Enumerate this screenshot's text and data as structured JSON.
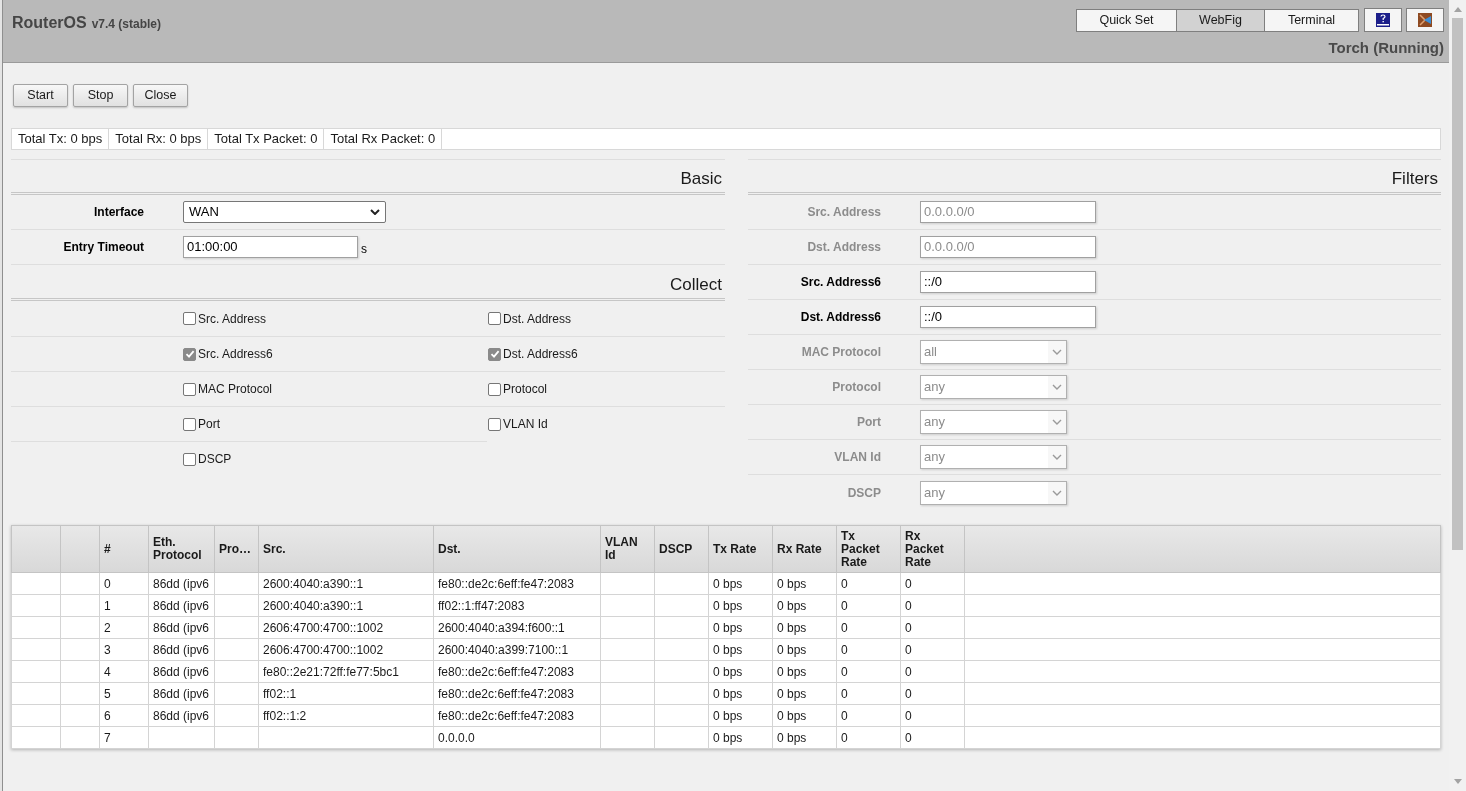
{
  "header": {
    "product": "RouterOS",
    "version": "v7.4 (stable)",
    "tabs": [
      {
        "label": "Quick Set",
        "selected": false
      },
      {
        "label": "WebFig",
        "selected": true
      },
      {
        "label": "Terminal",
        "selected": false
      }
    ],
    "page_title": "Torch (Running)"
  },
  "toolbar": {
    "buttons": [
      "Start",
      "Stop",
      "Close"
    ]
  },
  "status_bar": [
    "Total Tx: 0 bps",
    "Total Rx: 0 bps",
    "Total Tx Packet: 0",
    "Total Rx Packet: 0"
  ],
  "basic": {
    "title": "Basic",
    "fields": [
      {
        "label": "Interface",
        "kind": "select",
        "value": "WAN"
      },
      {
        "label": "Entry Timeout",
        "kind": "text",
        "value": "01:00:00",
        "unit": "s"
      }
    ]
  },
  "collect": {
    "title": "Collect",
    "options": [
      {
        "label": "Src. Address",
        "checked": false
      },
      {
        "label": "Dst. Address",
        "checked": false
      },
      {
        "label": "Src. Address6",
        "checked": true
      },
      {
        "label": "Dst. Address6",
        "checked": true
      },
      {
        "label": "MAC Protocol",
        "checked": false
      },
      {
        "label": "Protocol",
        "checked": false
      },
      {
        "label": "Port",
        "checked": false
      },
      {
        "label": "VLAN Id",
        "checked": false
      },
      {
        "label": "DSCP",
        "checked": false
      }
    ]
  },
  "filters": {
    "title": "Filters",
    "fields": [
      {
        "label": "Src. Address",
        "kind": "text",
        "value": "0.0.0.0/0",
        "disabled": true
      },
      {
        "label": "Dst. Address",
        "kind": "text",
        "value": "0.0.0.0/0",
        "disabled": true
      },
      {
        "label": "Src. Address6",
        "kind": "text",
        "value": "::/0",
        "disabled": false
      },
      {
        "label": "Dst. Address6",
        "kind": "text",
        "value": "::/0",
        "disabled": false
      },
      {
        "label": "MAC Protocol",
        "kind": "select",
        "value": "all",
        "disabled": true
      },
      {
        "label": "Protocol",
        "kind": "select",
        "value": "any",
        "disabled": true
      },
      {
        "label": "Port",
        "kind": "select",
        "value": "any",
        "disabled": true
      },
      {
        "label": "VLAN Id",
        "kind": "select",
        "value": "any",
        "disabled": true
      },
      {
        "label": "DSCP",
        "kind": "select",
        "value": "any",
        "disabled": true
      }
    ]
  },
  "table": {
    "columns": [
      null,
      null,
      "#",
      "Eth. Protocol",
      "Pro…",
      "Src.",
      "Dst.",
      "VLAN Id",
      "DSCP",
      "Tx Rate",
      "Rx Rate",
      "Tx Packet Rate",
      "Rx Packet Rate"
    ],
    "rows": [
      [
        null,
        null,
        "0",
        "86dd (ipv6",
        null,
        "2600:4040:a390::1",
        "fe80::de2c:6eff:fe47:2083",
        null,
        null,
        "0 bps",
        "0 bps",
        "0",
        "0"
      ],
      [
        null,
        null,
        "1",
        "86dd (ipv6",
        null,
        "2600:4040:a390::1",
        "ff02::1:ff47:2083",
        null,
        null,
        "0 bps",
        "0 bps",
        "0",
        "0"
      ],
      [
        null,
        null,
        "2",
        "86dd (ipv6",
        null,
        "2606:4700:4700::1002",
        "2600:4040:a394:f600::1",
        null,
        null,
        "0 bps",
        "0 bps",
        "0",
        "0"
      ],
      [
        null,
        null,
        "3",
        "86dd (ipv6",
        null,
        "2606:4700:4700::1002",
        "2600:4040:a399:7100::1",
        null,
        null,
        "0 bps",
        "0 bps",
        "0",
        "0"
      ],
      [
        null,
        null,
        "4",
        "86dd (ipv6",
        null,
        "fe80::2e21:72ff:fe77:5bc1",
        "fe80::de2c:6eff:fe47:2083",
        null,
        null,
        "0 bps",
        "0 bps",
        "0",
        "0"
      ],
      [
        null,
        null,
        "5",
        "86dd (ipv6",
        null,
        "ff02::1",
        "fe80::de2c:6eff:fe47:2083",
        null,
        null,
        "0 bps",
        "0 bps",
        "0",
        "0"
      ],
      [
        null,
        null,
        "6",
        "86dd (ipv6",
        null,
        "ff02::1:2",
        "fe80::de2c:6eff:fe47:2083",
        null,
        null,
        "0 bps",
        "0 bps",
        "0",
        "0"
      ],
      [
        null,
        null,
        "7",
        null,
        null,
        null,
        "0.0.0.0",
        null,
        null,
        "0 bps",
        "0 bps",
        "0",
        "0"
      ]
    ]
  }
}
